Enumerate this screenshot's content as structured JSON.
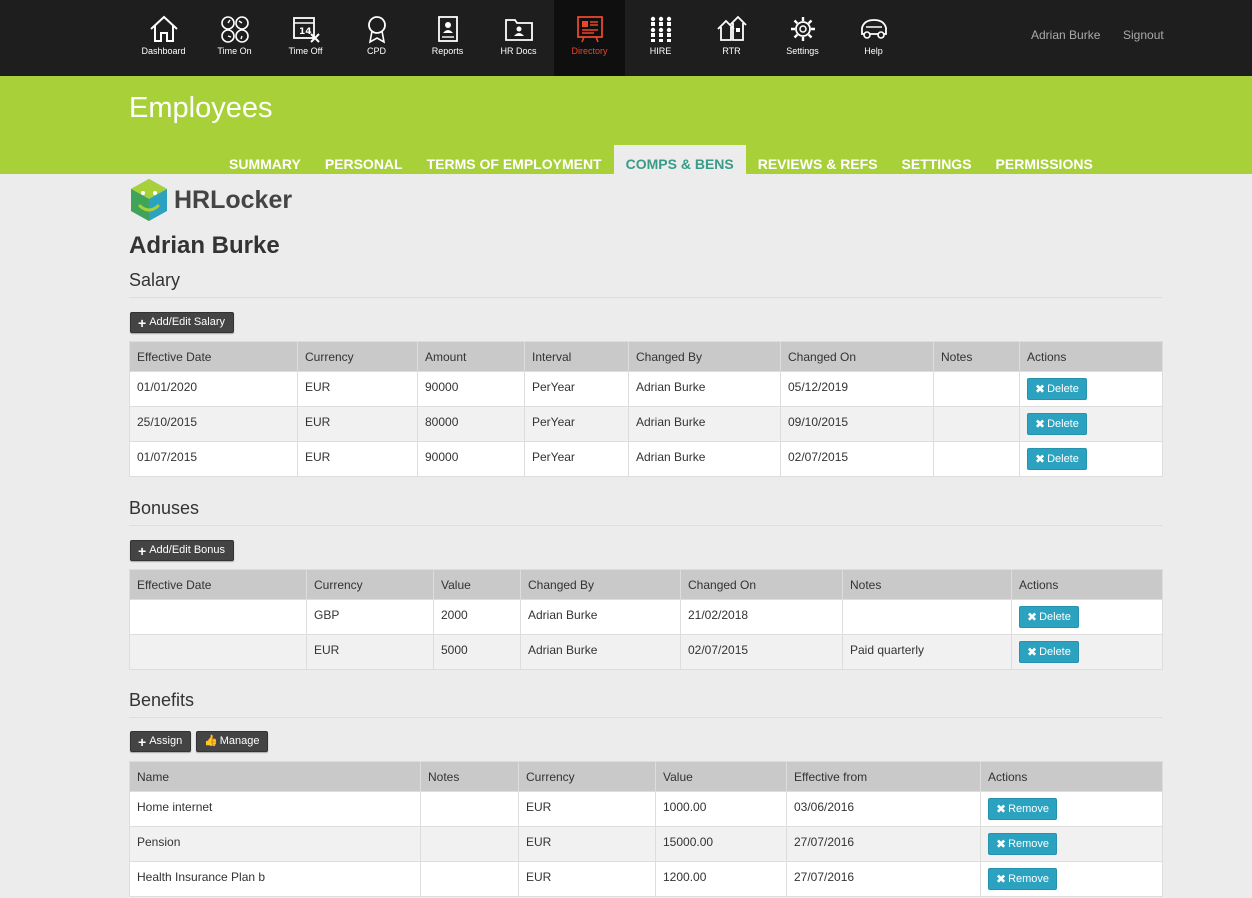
{
  "nav": {
    "items": [
      {
        "label": "Dashboard",
        "icon": "house-icon"
      },
      {
        "label": "Time On",
        "icon": "clocks-icon"
      },
      {
        "label": "Time Off",
        "icon": "calendar-off-icon"
      },
      {
        "label": "CPD",
        "icon": "award-ribbon-icon"
      },
      {
        "label": "Reports",
        "icon": "report-document-icon"
      },
      {
        "label": "HR Docs",
        "icon": "folder-person-icon"
      },
      {
        "label": "Directory",
        "icon": "directory-board-icon"
      },
      {
        "label": "HIRE",
        "icon": "people-grid-icon"
      },
      {
        "label": "RTR",
        "icon": "houses-icon"
      },
      {
        "label": "Settings",
        "icon": "gear-icon"
      },
      {
        "label": "Help",
        "icon": "car-icon"
      }
    ],
    "active": "Directory",
    "active_color": "#e8472c",
    "user": "Adrian Burke",
    "signout": "Signout"
  },
  "header": {
    "title": "Employees",
    "tabs": [
      "SUMMARY",
      "PERSONAL",
      "TERMS OF EMPLOYMENT",
      "COMPS & BENS",
      "REVIEWS & REFS",
      "SETTINGS",
      "PERMISSIONS"
    ],
    "active_tab": "COMPS & BENS",
    "accent": "#a8d139"
  },
  "logo": {
    "text": "HRLocker"
  },
  "employee": {
    "name": "Adrian Burke"
  },
  "salary": {
    "title": "Salary",
    "add_button": "Add/Edit Salary",
    "columns": [
      "Effective Date",
      "Currency",
      "Amount",
      "Interval",
      "Changed By",
      "Changed On",
      "Notes",
      "Actions"
    ],
    "rows": [
      {
        "effective_date": "01/01/2020",
        "currency": "EUR",
        "amount": "90000",
        "interval": "PerYear",
        "changed_by": "Adrian Burke",
        "changed_on": "05/12/2019",
        "notes": "",
        "action": "Delete"
      },
      {
        "effective_date": "25/10/2015",
        "currency": "EUR",
        "amount": "80000",
        "interval": "PerYear",
        "changed_by": "Adrian Burke",
        "changed_on": "09/10/2015",
        "notes": "",
        "action": "Delete"
      },
      {
        "effective_date": "01/07/2015",
        "currency": "EUR",
        "amount": "90000",
        "interval": "PerYear",
        "changed_by": "Adrian Burke",
        "changed_on": "02/07/2015",
        "notes": "",
        "action": "Delete"
      }
    ]
  },
  "bonuses": {
    "title": "Bonuses",
    "add_button": "Add/Edit Bonus",
    "columns": [
      "Effective Date",
      "Currency",
      "Value",
      "Changed By",
      "Changed On",
      "Notes",
      "Actions"
    ],
    "rows": [
      {
        "effective_date": "",
        "currency": "GBP",
        "value": "2000",
        "changed_by": "Adrian Burke",
        "changed_on": "21/02/2018",
        "notes": "",
        "action": "Delete"
      },
      {
        "effective_date": "",
        "currency": "EUR",
        "value": "5000",
        "changed_by": "Adrian Burke",
        "changed_on": "02/07/2015",
        "notes": "Paid quarterly",
        "action": "Delete"
      }
    ]
  },
  "benefits": {
    "title": "Benefits",
    "assign_button": "Assign",
    "manage_button": "Manage",
    "columns": [
      "Name",
      "Notes",
      "Currency",
      "Value",
      "Effective from",
      "Actions"
    ],
    "rows": [
      {
        "name": "Home internet",
        "notes": "",
        "currency": "EUR",
        "value": "1000.00",
        "effective_from": "03/06/2016",
        "action": "Remove"
      },
      {
        "name": "Pension",
        "notes": "",
        "currency": "EUR",
        "value": "15000.00",
        "effective_from": "27/07/2016",
        "action": "Remove"
      },
      {
        "name": "Health Insurance Plan b",
        "notes": "",
        "currency": "EUR",
        "value": "1200.00",
        "effective_from": "27/07/2016",
        "action": "Remove"
      }
    ]
  },
  "colors": {
    "action_button": "#2aa2c0",
    "table_header": "#c9c9c9",
    "topbar": "#1e1e1e"
  }
}
